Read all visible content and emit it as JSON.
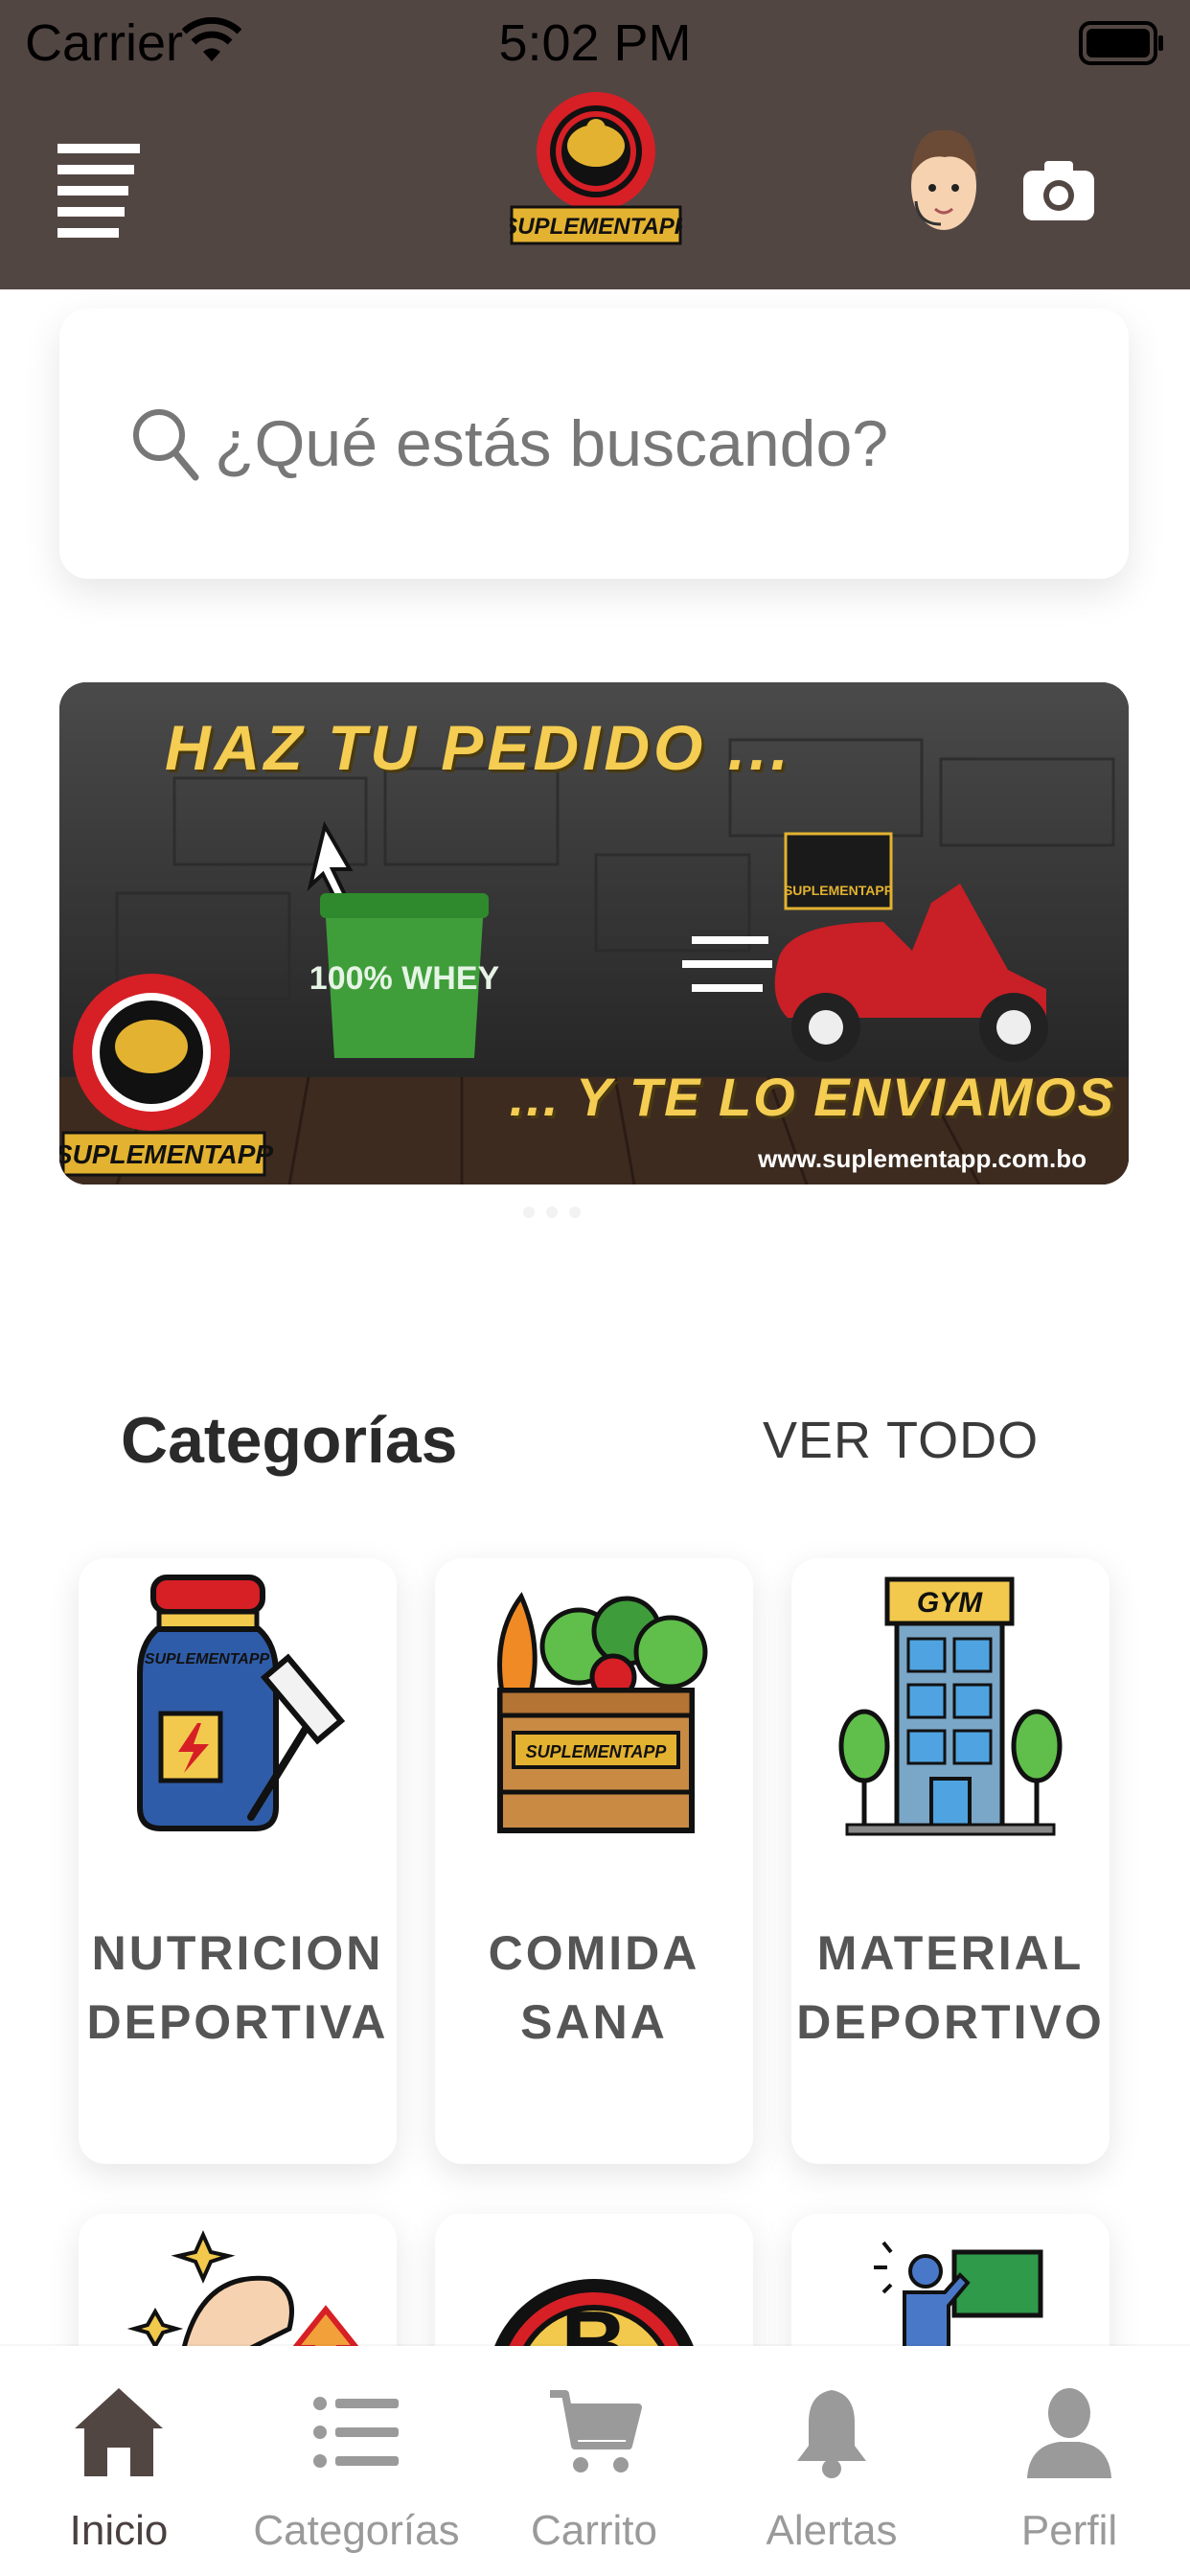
{
  "status_bar": {
    "carrier": "Carrier",
    "time": "5:02 PM"
  },
  "app_bar": {
    "logo_text": "SUPLEMENTAPP"
  },
  "search": {
    "placeholder": "¿Qué estás buscando?"
  },
  "banner": {
    "headline": "HAZ TU PEDIDO ...",
    "tagline": "... Y TE LO ENVIAMOS",
    "url": "www.suplementapp.com.bo",
    "logo_text": "SUPLEMENTAPP",
    "bucket_text": "100% WHEY",
    "box_text": "SUPLEMENTAPP"
  },
  "categories": {
    "title": "Categorías",
    "see_all": "VER TODO",
    "items": [
      {
        "line1": "NUTRICION",
        "line2": "DEPORTIVA",
        "icon": "supplement-bottle-icon",
        "art_text": "SUPLEMENTAPP"
      },
      {
        "line1": "COMIDA",
        "line2": "SANA",
        "icon": "vegetable-crate-icon",
        "art_text": "SUPLEMENTAPP"
      },
      {
        "line1": "MATERIAL",
        "line2": "DEPORTIVO",
        "icon": "gym-building-icon",
        "art_text": "GYM"
      },
      {
        "line1": "",
        "line2": "",
        "icon": "strength-arm-icon"
      },
      {
        "line1": "",
        "line2": "",
        "icon": "brand-badge-icon",
        "art_text": "B"
      },
      {
        "line1": "",
        "line2": "",
        "icon": "trainer-board-icon"
      }
    ]
  },
  "tabbar": {
    "items": [
      {
        "label": "Inicio",
        "icon": "home-icon",
        "active": true
      },
      {
        "label": "Categorías",
        "icon": "list-icon"
      },
      {
        "label": "Carrito",
        "icon": "cart-icon"
      },
      {
        "label": "Alertas",
        "icon": "bell-icon"
      },
      {
        "label": "Perfil",
        "icon": "person-icon"
      }
    ]
  },
  "colors": {
    "header_bg": "#524643",
    "accent_yellow": "#f4cd52",
    "logo_red": "#d71f26"
  }
}
